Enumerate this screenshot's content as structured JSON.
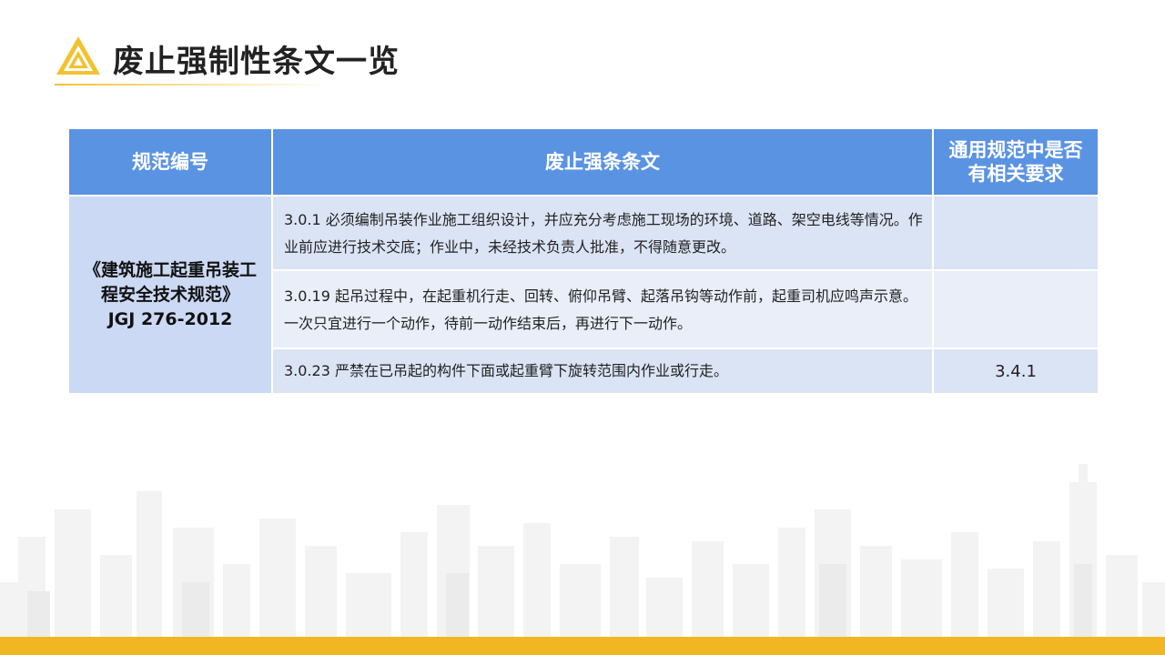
{
  "header": {
    "title": "废止强制性条文一览",
    "logo_icon": "triangle-logo-icon",
    "accent_color": "#f2c230"
  },
  "table": {
    "columns": [
      "规范编号",
      "废止强条条文",
      "通用规范中是否有相关要求"
    ],
    "standard": {
      "name": "《建筑施工起重吊装工程安全技术规范》",
      "code": "JGJ 276-2012"
    },
    "rows": [
      {
        "clause": "3.0.1 必须编制吊装作业施工组织设计，并应充分考虑施工现场的环境、道路、架空电线等情况。作业前应进行技术交底；作业中，未经技术负责人批准，不得随意更改。",
        "requirement": ""
      },
      {
        "clause": "3.0.19 起吊过程中，在起重机行走、回转、俯仰吊臂、起落吊钩等动作前，起重司机应鸣声示意。一次只宜进行一个动作，待前一动作结束后，再进行下一动作。",
        "requirement": ""
      },
      {
        "clause": "3.0.23 严禁在已吊起的构件下面或起重臂下旋转范围内作业或行走。",
        "requirement": "3.4.1"
      }
    ],
    "header_color": "#5b93e3",
    "row_color_a": "#dbe4f5",
    "row_color_b": "#e9eef9"
  },
  "footer": {
    "bar_color": "#f0b722",
    "decoration_icon": "city-skyline-icon"
  }
}
